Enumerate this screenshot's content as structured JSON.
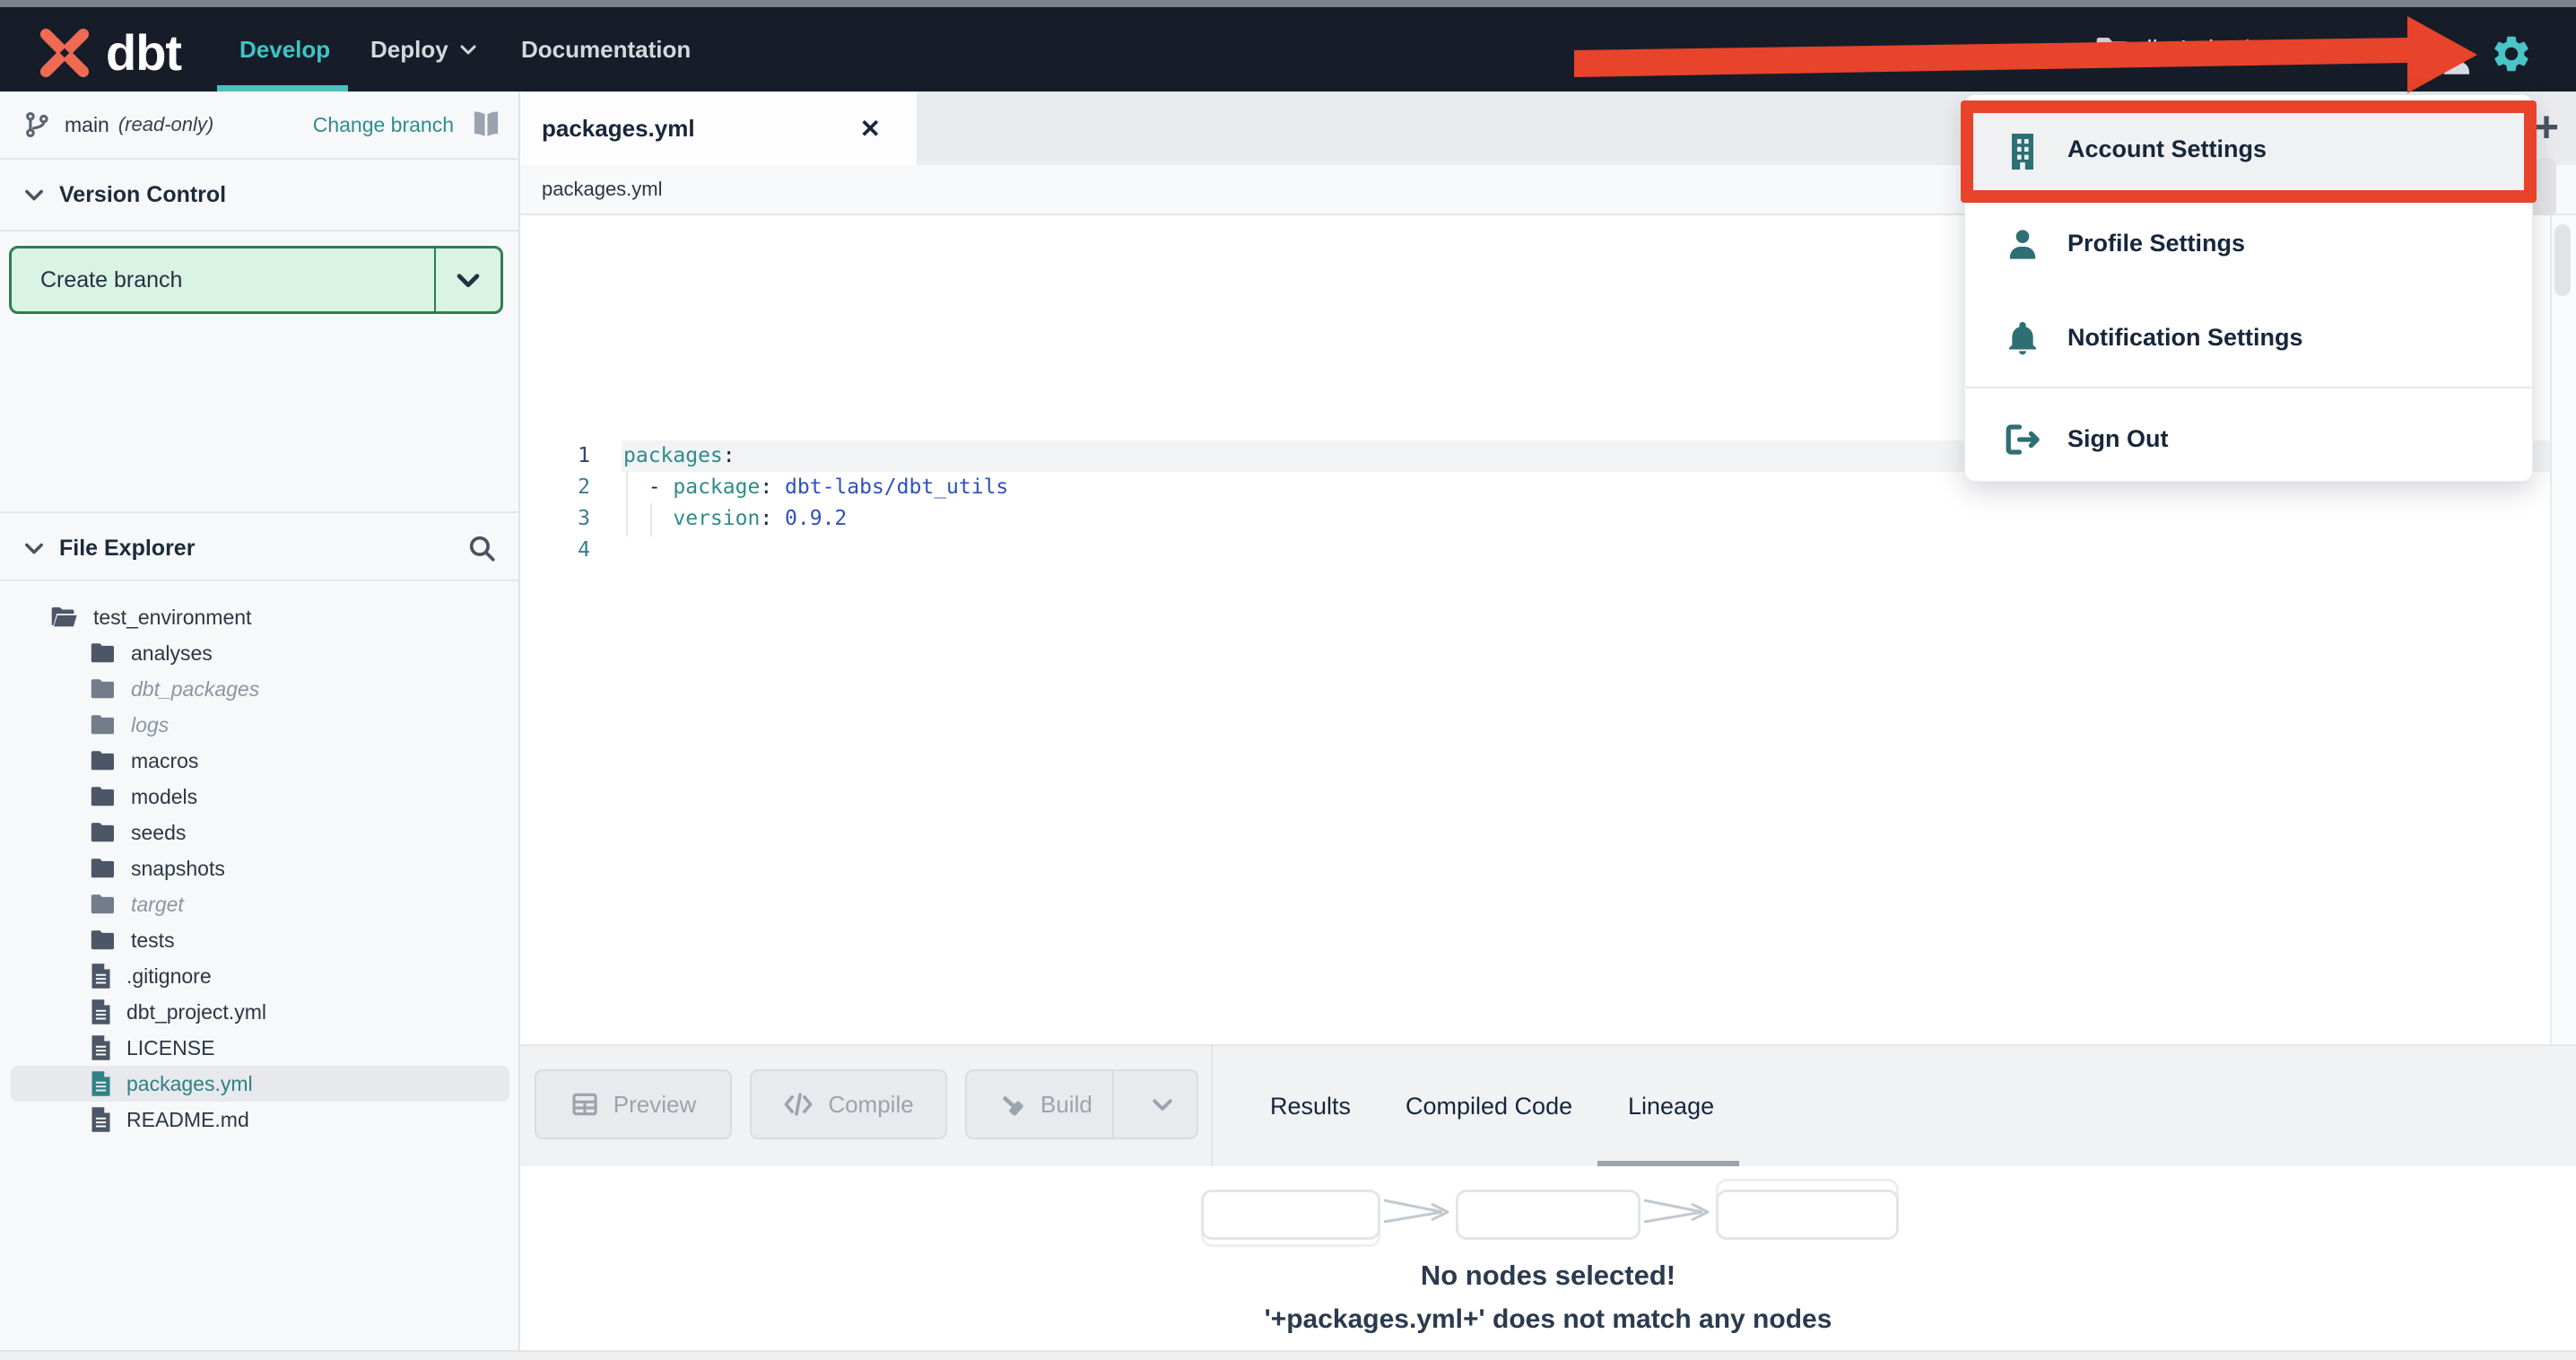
{
  "navbar": {
    "logo_text": "dbt",
    "nav": [
      {
        "label": "Develop",
        "active": true
      },
      {
        "label": "Deploy",
        "caret": true
      },
      {
        "label": "Documentation"
      }
    ],
    "context": "dbt Labs / Analytics"
  },
  "account_menu": {
    "items": [
      {
        "label": "Account Settings",
        "icon": "building-icon",
        "highlighted": true
      },
      {
        "label": "Profile Settings",
        "icon": "person-icon"
      },
      {
        "label": "Notification Settings",
        "icon": "bell-icon"
      },
      {
        "label": "Sign Out",
        "icon": "sign-out-icon"
      }
    ]
  },
  "version_control": {
    "title": "Version Control",
    "branch": "main",
    "mode": "(read-only)",
    "change_branch": "Change branch",
    "create_branch": "Create branch"
  },
  "file_explorer": {
    "title": "File Explorer",
    "root": "test_environment",
    "items": [
      {
        "name": "analyses",
        "type": "folder"
      },
      {
        "name": "dbt_packages",
        "type": "folder",
        "muted": true
      },
      {
        "name": "logs",
        "type": "folder",
        "muted": true
      },
      {
        "name": "macros",
        "type": "folder"
      },
      {
        "name": "models",
        "type": "folder"
      },
      {
        "name": "seeds",
        "type": "folder"
      },
      {
        "name": "snapshots",
        "type": "folder"
      },
      {
        "name": "target",
        "type": "folder",
        "muted": true
      },
      {
        "name": "tests",
        "type": "folder"
      },
      {
        "name": ".gitignore",
        "type": "file"
      },
      {
        "name": "dbt_project.yml",
        "type": "file"
      },
      {
        "name": "LICENSE",
        "type": "file"
      },
      {
        "name": "packages.yml",
        "type": "file",
        "selected": true
      },
      {
        "name": "README.md",
        "type": "file"
      }
    ]
  },
  "editor": {
    "tab": "packages.yml",
    "close_glyph": "✕",
    "add_tab_glyph": "+",
    "breadcrumb": "packages.yml",
    "lines": [
      {
        "n": "1",
        "tokens": [
          {
            "t": "packages",
            "c": "key"
          },
          {
            "t": ":",
            "c": "punc"
          }
        ]
      },
      {
        "n": "2",
        "tokens": [
          {
            "t": "  - ",
            "c": "punc"
          },
          {
            "t": "package",
            "c": "key"
          },
          {
            "t": ": ",
            "c": "punc"
          },
          {
            "t": "dbt-labs/dbt_utils",
            "c": "val"
          }
        ]
      },
      {
        "n": "3",
        "tokens": [
          {
            "t": "    ",
            "c": "punc"
          },
          {
            "t": "version",
            "c": "key"
          },
          {
            "t": ": ",
            "c": "punc"
          },
          {
            "t": "0.9.2",
            "c": "val"
          }
        ]
      },
      {
        "n": "4",
        "tokens": []
      }
    ]
  },
  "actions": {
    "preview": "Preview",
    "compile": "Compile",
    "build": "Build"
  },
  "results_panel": {
    "tabs": [
      {
        "label": "Results"
      },
      {
        "label": "Compiled Code"
      },
      {
        "label": "Lineage",
        "active": true
      }
    ]
  },
  "lineage": {
    "title": "No nodes selected!",
    "subtitle": "'+packages.yml+' does not match any nodes"
  },
  "colors": {
    "navbar_bg": "#161d29",
    "accent_teal": "#3fc4c5",
    "annotation_red": "#e8432b",
    "create_branch_bg": "#d9f3e5",
    "create_branch_border": "#2f7d52",
    "menu_icon_teal": "#2e6f74",
    "code_key": "#2e8b8b",
    "code_value": "#2d50c0",
    "selected_file_teal": "#2f8185",
    "logo_orange": "#ee6a52"
  }
}
